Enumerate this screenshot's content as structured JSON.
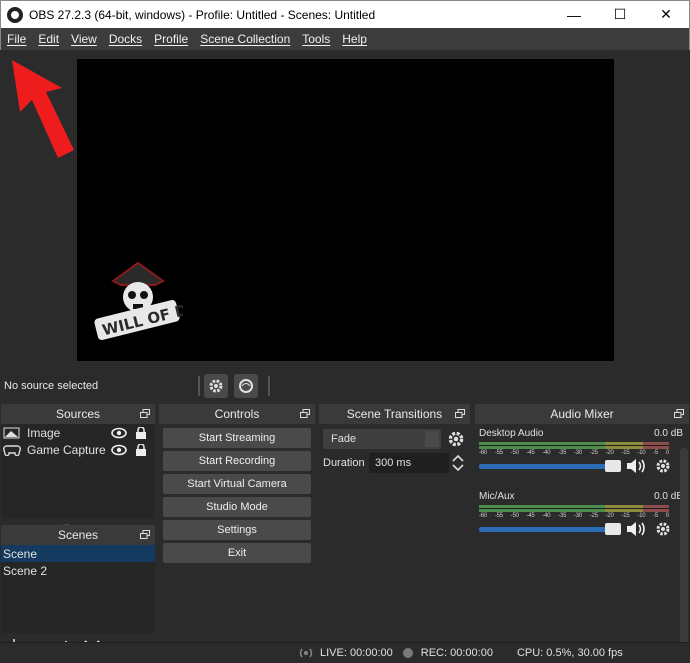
{
  "window": {
    "title": "OBS 27.2.3 (64-bit, windows) - Profile: Untitled - Scenes: Untitled",
    "minimize": "—",
    "maximize": "☐",
    "close": "✕"
  },
  "menu": [
    "File",
    "Edit",
    "View",
    "Docks",
    "Profile",
    "Scene Collection",
    "Tools",
    "Help"
  ],
  "preview": {
    "logo_text": "WILL OF D"
  },
  "source_bar": {
    "status": "No source selected"
  },
  "sources": {
    "title": "Sources",
    "items": [
      {
        "label": "Image",
        "icon": "image-icon"
      },
      {
        "label": "Game Capture",
        "icon": "gamepad-icon"
      }
    ]
  },
  "scenes": {
    "title": "Scenes",
    "items": [
      "Scene",
      "Scene 2"
    ],
    "selected": "Scene"
  },
  "controls": {
    "title": "Controls",
    "buttons": [
      "Start Streaming",
      "Start Recording",
      "Start Virtual Camera",
      "Studio Mode",
      "Settings",
      "Exit"
    ]
  },
  "transitions": {
    "title": "Scene Transitions",
    "selected": "Fade",
    "duration_label": "Duration",
    "duration_value": "300 ms"
  },
  "mixer": {
    "title": "Audio Mixer",
    "ticks": [
      "-60",
      "-55",
      "-50",
      "-45",
      "-40",
      "-35",
      "-30",
      "-25",
      "-20",
      "-15",
      "-10",
      "-5",
      "0"
    ],
    "channels": [
      {
        "name": "Desktop Audio",
        "level": "0.0 dB",
        "volume": 1.0
      },
      {
        "name": "Mic/Aux",
        "level": "0.0 dB",
        "volume": 1.0
      }
    ]
  },
  "status": {
    "live": "LIVE: 00:00:00",
    "rec": "REC: 00:00:00",
    "cpu": "CPU: 0.5%, 30.00 fps"
  },
  "colors": {
    "accent": "#2c6cb5",
    "selection": "#143a5f",
    "arrow": "#ee1c1c"
  }
}
